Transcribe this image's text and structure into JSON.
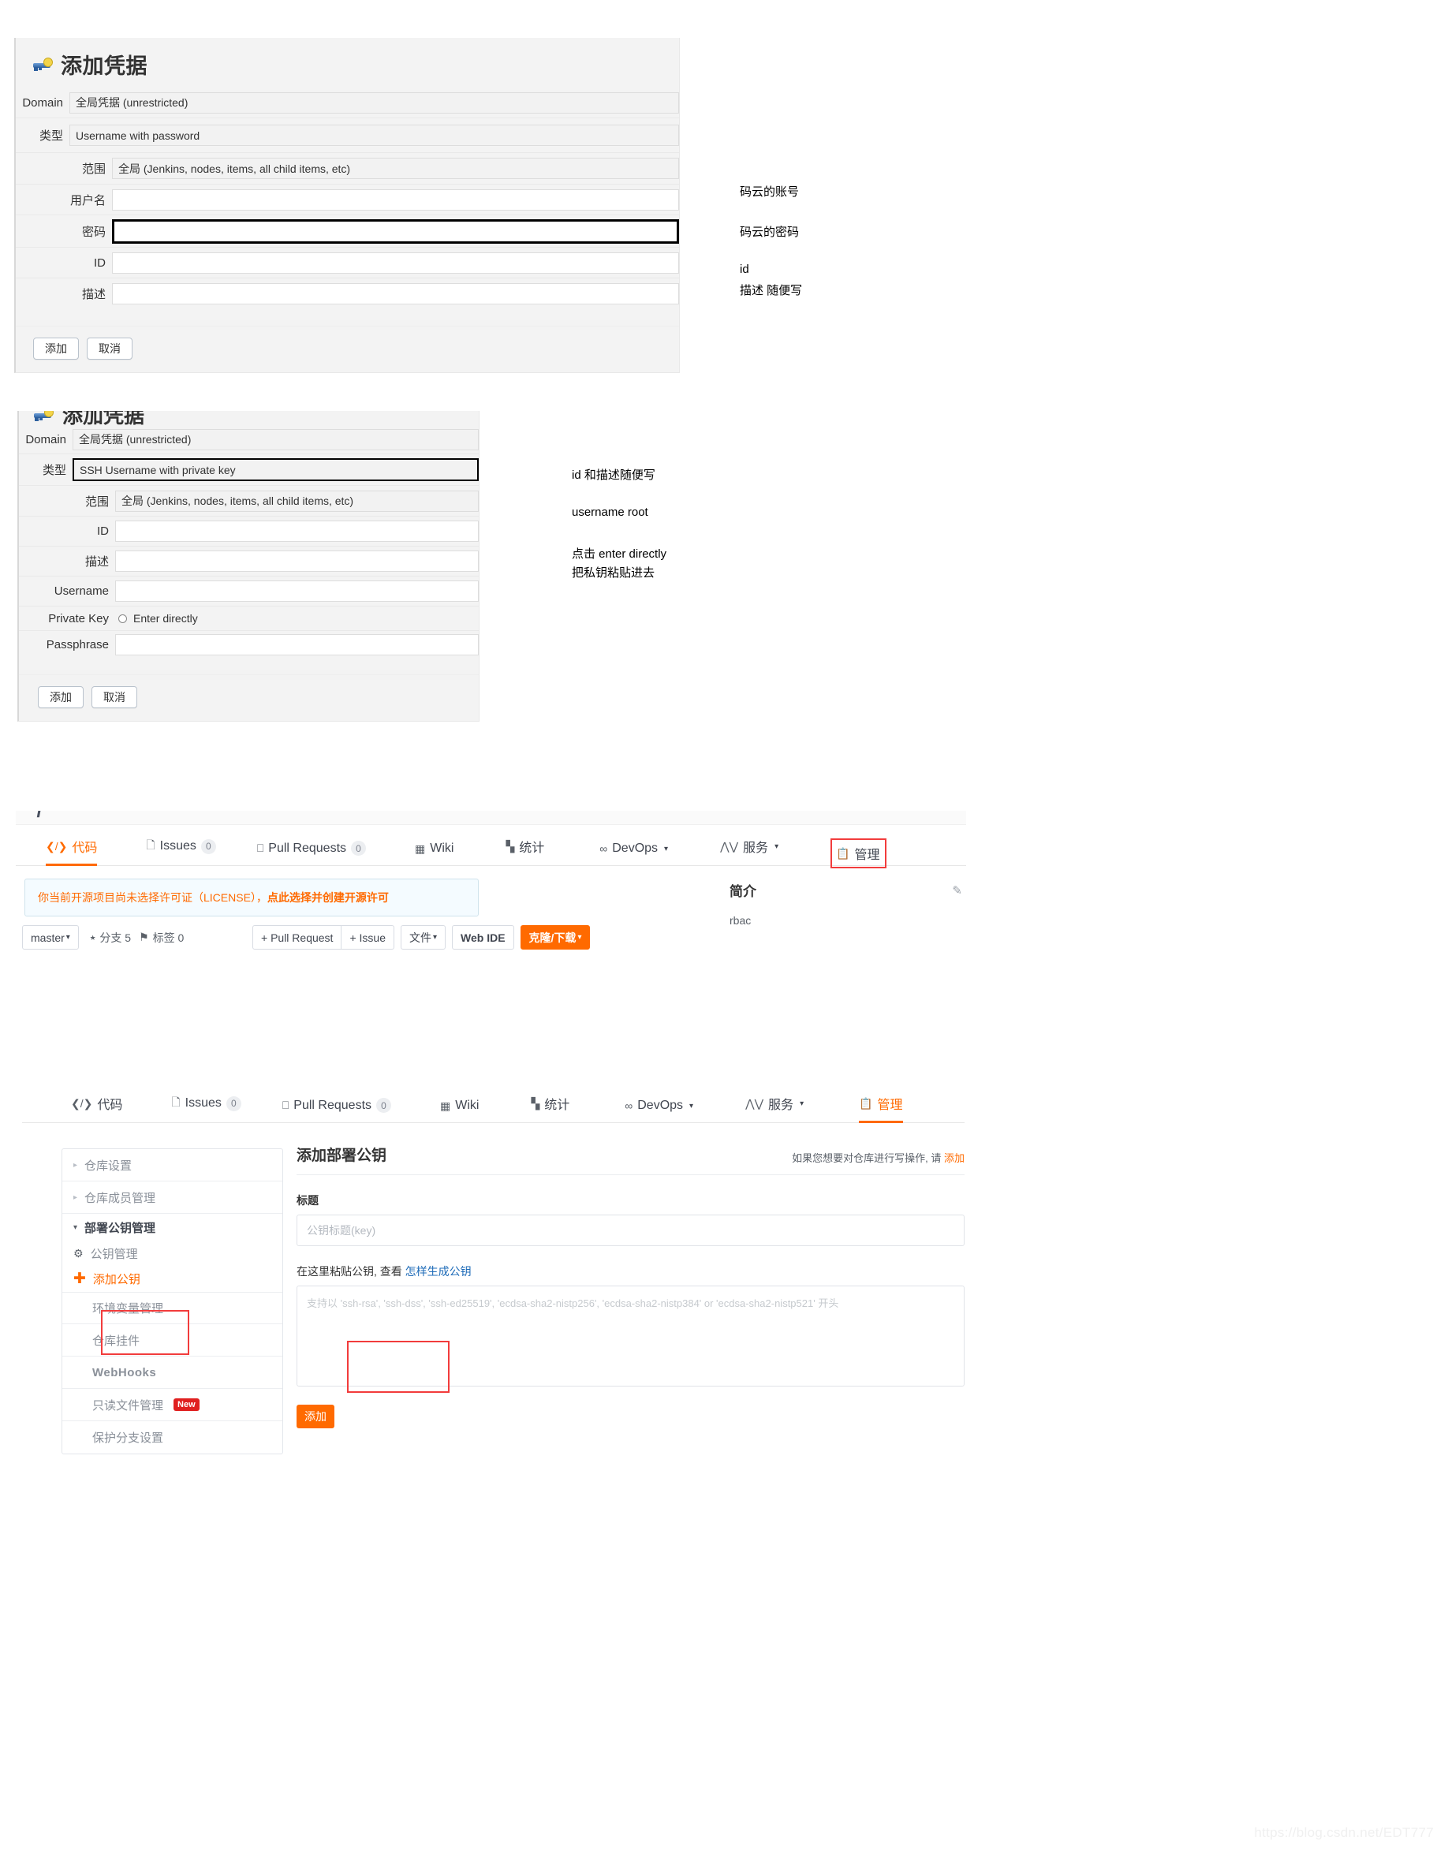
{
  "watermark": "https://blog.csdn.net/EDT777",
  "jenkins_credential_userpass": {
    "title": "添加凭据",
    "icon": "key-icon",
    "rows": {
      "domain_label": "Domain",
      "domain_value": "全局凭据 (unrestricted)",
      "type_label": "类型",
      "type_value": "Username with password",
      "scope_label": "范围",
      "scope_value": "全局 (Jenkins, nodes, items, all child items, etc)",
      "username_label": "用户名",
      "username_value": "",
      "password_label": "密码",
      "password_value": "",
      "id_label": "ID",
      "id_value": "",
      "desc_label": "描述",
      "desc_value": ""
    },
    "buttons": {
      "add": "添加",
      "cancel": "取消"
    },
    "notes": [
      "码云的账号",
      "码云的密码",
      "id",
      "描述 随便写"
    ]
  },
  "jenkins_credential_ssh": {
    "title": "添加凭据",
    "icon": "key-icon",
    "rows": {
      "domain_label": "Domain",
      "domain_value": "全局凭据 (unrestricted)",
      "type_label": "类型",
      "type_value": "SSH Username with private key",
      "scope_label": "范围",
      "scope_value": "全局 (Jenkins, nodes, items, all child items, etc)",
      "id_label": "ID",
      "id_value": "",
      "desc_label": "描述",
      "desc_value": "",
      "username_label": "Username",
      "username_value": "",
      "privatekey_label": "Private Key",
      "privatekey_option": "Enter directly",
      "passphrase_label": "Passphrase",
      "passphrase_value": ""
    },
    "buttons": {
      "add": "添加",
      "cancel": "取消"
    },
    "notes": [
      "id 和描述随便写",
      "username   root",
      "点击 enter directly",
      "把私钥粘贴进去"
    ]
  },
  "gitee_repo": {
    "tabs": [
      {
        "label": "代码",
        "icon": "code-icon",
        "count": null,
        "active": true,
        "caret": false
      },
      {
        "label": "Issues",
        "icon": "issue-icon",
        "count": "0",
        "active": false,
        "caret": false
      },
      {
        "label": "Pull Requests",
        "icon": "pr-icon",
        "count": "0",
        "active": false,
        "caret": false
      },
      {
        "label": "Wiki",
        "icon": "wiki-icon",
        "count": null,
        "active": false,
        "caret": false
      },
      {
        "label": "统计",
        "icon": "stats-icon",
        "count": null,
        "active": false,
        "caret": false
      },
      {
        "label": "DevOps",
        "icon": "devops-icon",
        "count": null,
        "active": false,
        "caret": true
      },
      {
        "label": "服务",
        "icon": "service-icon",
        "count": null,
        "active": false,
        "caret": true
      },
      {
        "label": "管理",
        "icon": "manage-icon",
        "count": null,
        "active": false,
        "caret": false,
        "highlight": true
      }
    ],
    "license_notice_prefix": "你当前开源项目尚未选择许可证（LICENSE），",
    "license_notice_link": "点此选择并创建开源许可",
    "branch_selector": "master",
    "branch_count_label": "分支 5",
    "tag_count_label": "标签 0",
    "actions": [
      {
        "label": "+ Pull Request",
        "style": "plain"
      },
      {
        "label": "+ Issue",
        "style": "plain"
      },
      {
        "label": "文件",
        "style": "caret"
      },
      {
        "label": "Web IDE",
        "style": "bold"
      },
      {
        "label": "克隆/下载",
        "style": "orange-caret"
      }
    ],
    "sidebar_right": {
      "title": "简介",
      "body": "rbac",
      "edit_icon": "edit-icon"
    }
  },
  "gitee_deploy_key": {
    "tabs": [
      {
        "label": "代码",
        "icon": "code-icon",
        "count": null,
        "active": false,
        "caret": false
      },
      {
        "label": "Issues",
        "icon": "issue-icon",
        "count": "0",
        "active": false,
        "caret": false
      },
      {
        "label": "Pull Requests",
        "icon": "pr-icon",
        "count": "0",
        "active": false,
        "caret": false
      },
      {
        "label": "Wiki",
        "icon": "wiki-icon",
        "count": null,
        "active": false,
        "caret": false
      },
      {
        "label": "统计",
        "icon": "stats-icon",
        "count": null,
        "active": false,
        "caret": false
      },
      {
        "label": "DevOps",
        "icon": "devops-icon",
        "count": null,
        "active": false,
        "caret": true
      },
      {
        "label": "服务",
        "icon": "service-icon",
        "count": null,
        "active": false,
        "caret": true
      },
      {
        "label": "管理",
        "icon": "manage-icon",
        "count": null,
        "active": true,
        "caret": false
      }
    ],
    "sidebar": [
      {
        "label": "仓库设置",
        "icon": "triangle-right-icon",
        "state": "collapsed"
      },
      {
        "label": "仓库成员管理",
        "icon": "triangle-right-icon",
        "state": "collapsed"
      },
      {
        "label": "部署公钥管理",
        "icon": "triangle-down-icon",
        "state": "expanded"
      },
      {
        "label": "公钥管理",
        "icon": "gear-icon",
        "state": "child"
      },
      {
        "label": "添加公钥",
        "icon": "plus-icon",
        "state": "child-active"
      },
      {
        "label": "环境变量管理",
        "icon": "",
        "state": "item"
      },
      {
        "label": "仓库挂件",
        "icon": "",
        "state": "item"
      },
      {
        "label": "WebHooks",
        "icon": "",
        "state": "item"
      },
      {
        "label": "只读文件管理",
        "icon": "",
        "badge": "New",
        "state": "item"
      },
      {
        "label": "保护分支设置",
        "icon": "",
        "state": "item"
      }
    ],
    "page_title": "添加部署公钥",
    "page_hint_prefix": "如果您想要对仓库进行写操作, 请 ",
    "page_hint_link": "添加",
    "title_field_label": "标题",
    "title_field_placeholder": "公钥标题(key)",
    "key_field_label_prefix": "在这里粘贴公钥, 查看 ",
    "key_field_label_link": "怎样生成公钥",
    "key_field_placeholder": "支持以 'ssh-rsa', 'ssh-dss', 'ssh-ed25519', 'ecdsa-sha2-nistp256', 'ecdsa-sha2-nistp384' or 'ecdsa-sha2-nistp521' 开头",
    "submit_label": "添加"
  },
  "colors": {
    "accent_orange": "#ff6a00",
    "red_highlight": "#f23c3c",
    "badge_red": "#e02020",
    "link_blue": "#1e6bb8",
    "panel_grey": "#f3f3f3"
  }
}
